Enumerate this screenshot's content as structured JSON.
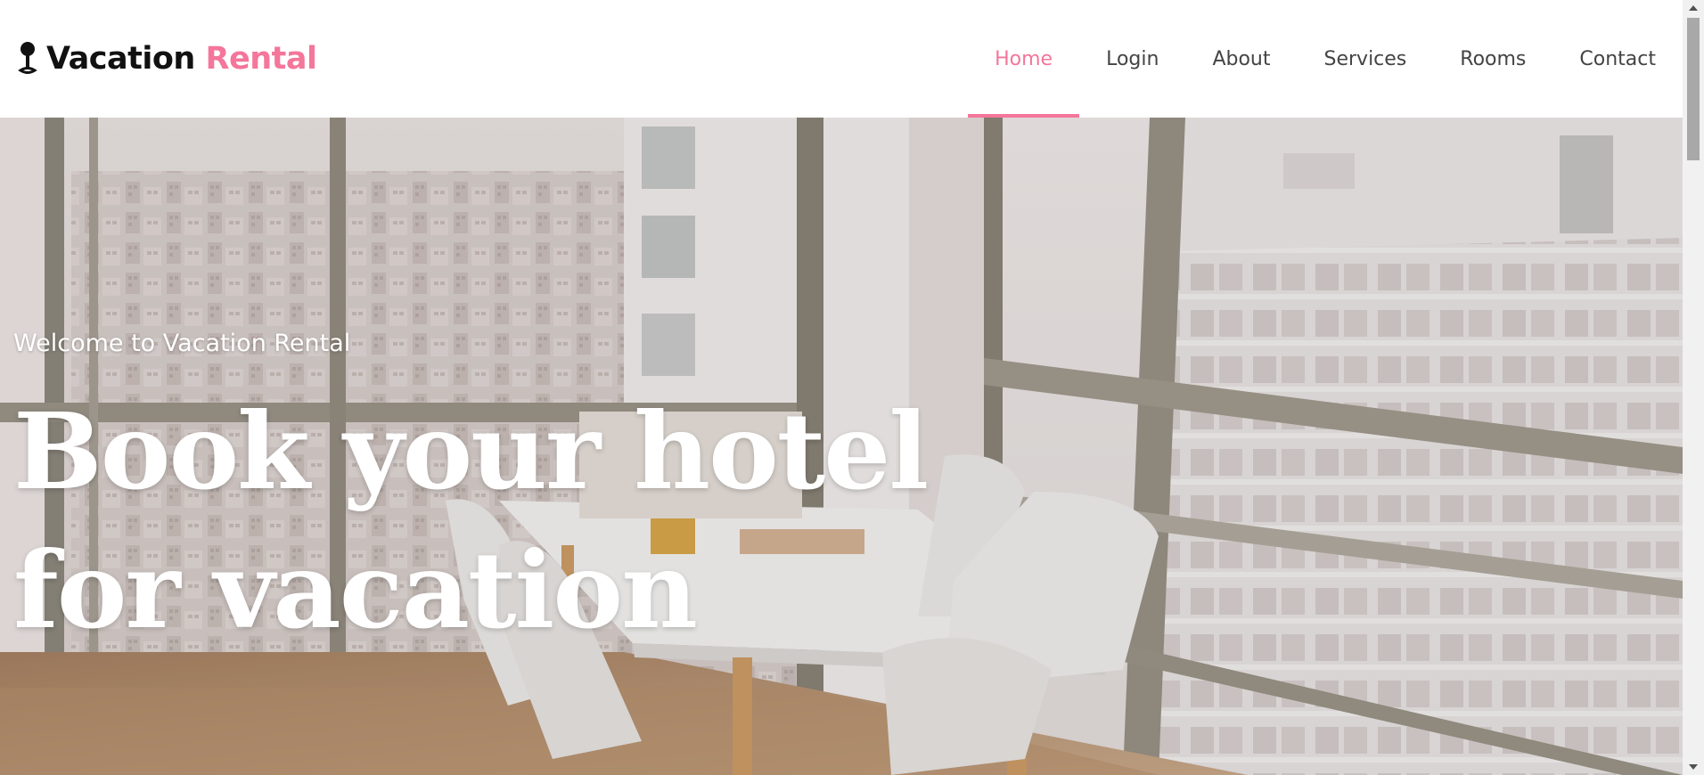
{
  "brand": {
    "icon": "map-pin-icon",
    "name_primary": "Vacation",
    "name_accent": "Rental",
    "accent_color": "#f4769a"
  },
  "nav": {
    "items": [
      {
        "label": "Home",
        "active": true
      },
      {
        "label": "Login",
        "active": false
      },
      {
        "label": "About",
        "active": false
      },
      {
        "label": "Services",
        "active": false
      },
      {
        "label": "Rooms",
        "active": false
      },
      {
        "label": "Contact",
        "active": false
      }
    ]
  },
  "hero": {
    "welcome": "Welcome to Vacation Rental",
    "title": "Book your hotel for vacation",
    "image": "apartment-dining-room-city-view-photo"
  },
  "scrollbar": {
    "up_icon": "scroll-up-arrow-icon",
    "down_icon": "scroll-down-arrow-icon"
  }
}
